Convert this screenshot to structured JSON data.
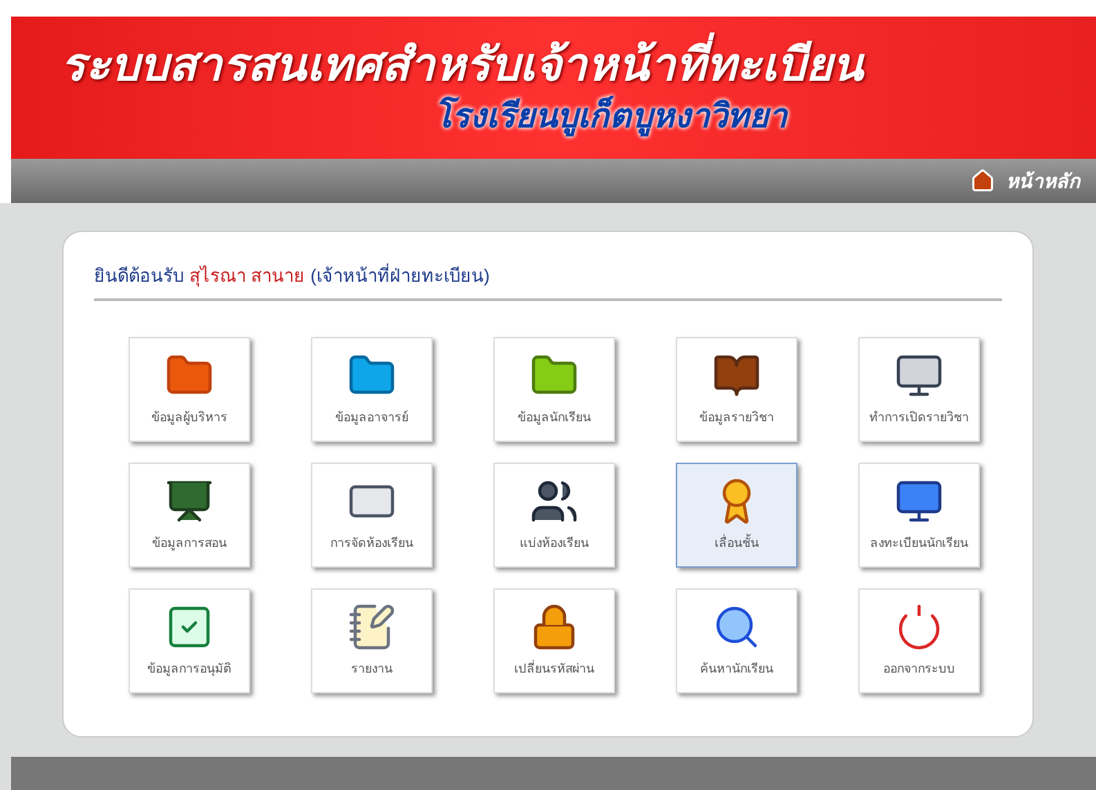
{
  "header": {
    "title": "ระบบสารสนเทศสำหรับเจ้าหน้าที่ทะเบียน",
    "subtitle": "โรงเรียนบูเก็ตบูหงาวิทยา"
  },
  "nav": {
    "home_link": "หน้าหลัก"
  },
  "welcome": {
    "greeting": "ยินดีต้อนรับ",
    "user_name": "สุไรณา สานาย",
    "role": "(เจ้าหน้าที่ฝ่ายทะเบียน)"
  },
  "tiles": [
    {
      "label": "ข้อมูลผู้บริหาร",
      "selected": false
    },
    {
      "label": "ข้อมูลอาจารย์",
      "selected": false
    },
    {
      "label": "ข้อมูลนักเรียน",
      "selected": false
    },
    {
      "label": "ข้อมูลรายวิชา",
      "selected": false
    },
    {
      "label": "ทำการเปิดรายวิชา",
      "selected": false
    },
    {
      "label": "ข้อมูลการสอน",
      "selected": false
    },
    {
      "label": "การจัดห้องเรียน",
      "selected": false
    },
    {
      "label": "แบ่งห้องเรียน",
      "selected": false
    },
    {
      "label": "เลื่อนชั้น",
      "selected": true
    },
    {
      "label": "ลงทะเบียนนักเรียน",
      "selected": false
    },
    {
      "label": "ข้อมูลการอนุมัติ",
      "selected": false
    },
    {
      "label": "รายงาน",
      "selected": false
    },
    {
      "label": "เปลี่ยนรหัสผ่าน",
      "selected": false
    },
    {
      "label": "ค้นหานักเรียน",
      "selected": false
    },
    {
      "label": "ออกจากระบบ",
      "selected": false
    }
  ]
}
